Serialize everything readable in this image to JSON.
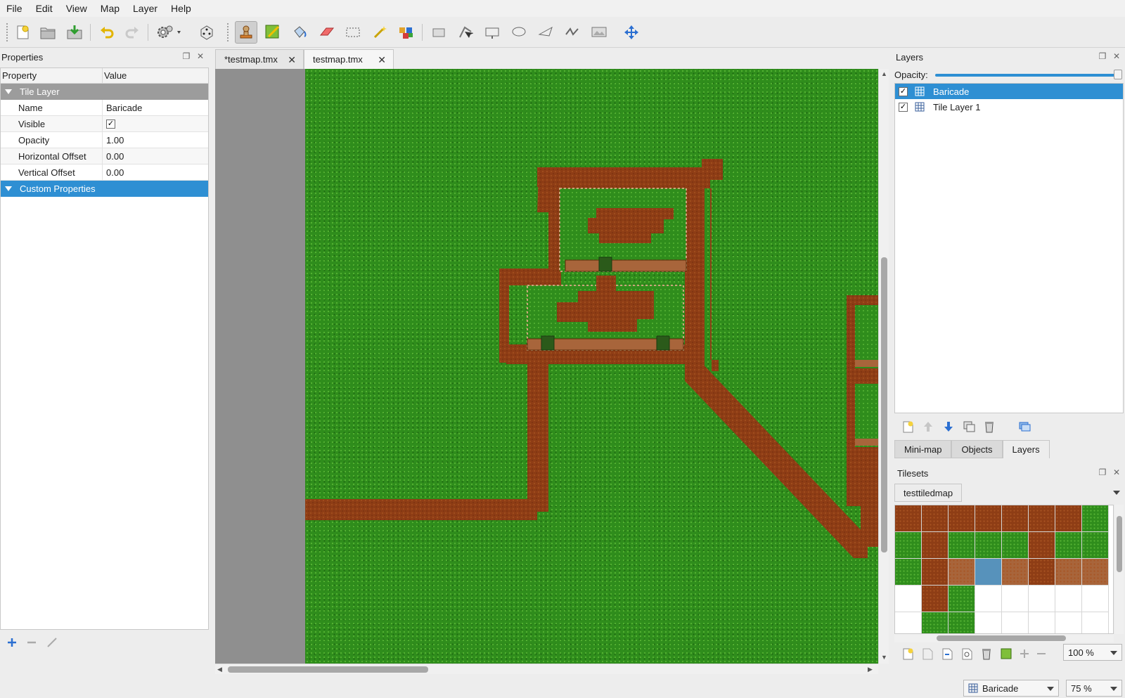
{
  "menu": [
    "File",
    "Edit",
    "View",
    "Map",
    "Layer",
    "Help"
  ],
  "properties_panel": {
    "title": "Properties",
    "col_property": "Property",
    "col_value": "Value",
    "group_tile_layer": "Tile Layer",
    "rows": [
      {
        "key": "Name",
        "value": "Baricade"
      },
      {
        "key": "Visible",
        "value": "✓"
      },
      {
        "key": "Opacity",
        "value": "1.00"
      },
      {
        "key": "Horizontal Offset",
        "value": "0.00"
      },
      {
        "key": "Vertical Offset",
        "value": "0.00"
      }
    ],
    "group_custom": "Custom Properties"
  },
  "tabs": [
    {
      "label": "*testmap.tmx"
    },
    {
      "label": "testmap.tmx"
    }
  ],
  "layers_panel": {
    "title": "Layers",
    "opacity_label": "Opacity:",
    "opacity_value": 1.0,
    "layers": [
      {
        "name": "Baricade",
        "visible": "✓"
      },
      {
        "name": "Tile Layer 1",
        "visible": "✓"
      }
    ],
    "dock_tabs": [
      "Mini-map",
      "Objects",
      "Layers"
    ]
  },
  "tilesets_panel": {
    "title": "Tilesets",
    "tab": "testtiledmap",
    "zoom": "100 %"
  },
  "statusbar": {
    "current_layer": "Baricade",
    "zoom": "75 %"
  },
  "colors": {
    "accent": "#2e8fd3",
    "grass": "#2f8d1c",
    "dirt": "#8e3d15"
  }
}
